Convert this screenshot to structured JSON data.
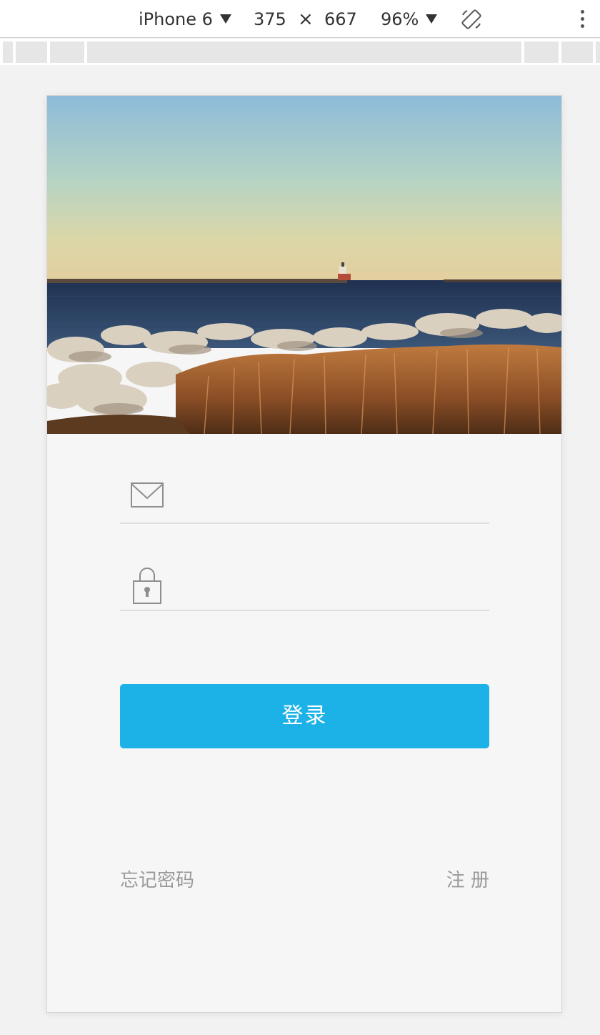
{
  "devtools": {
    "device": "iPhone 6",
    "width": "375",
    "times": "×",
    "height": "667",
    "zoom": "96%",
    "icons": [
      "caret-down-icon",
      "rotate-icon",
      "more-vertical-icon"
    ]
  },
  "login": {
    "email": {
      "icon": "mail-icon",
      "value": "",
      "placeholder": ""
    },
    "password": {
      "icon": "lock-icon",
      "value": "",
      "placeholder": ""
    },
    "login_button": "登录",
    "forgot_password": "忘记密码",
    "register": "注 册"
  },
  "colors": {
    "accent": "#1cb2e8",
    "link_text": "#9a9a9a",
    "page_background": "#f6f6f6",
    "divider": "#dedede"
  }
}
